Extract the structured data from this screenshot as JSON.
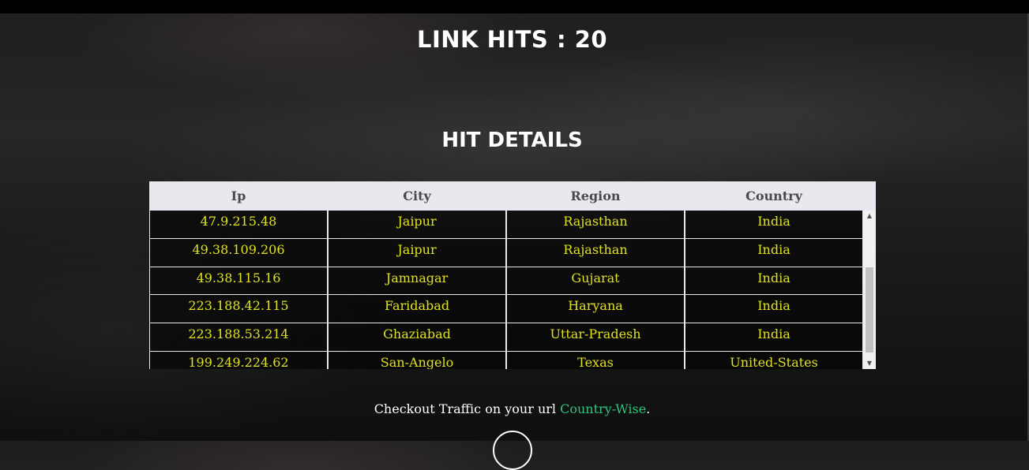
{
  "header": {
    "link_hits_label": "LINK HITS",
    "link_hits_separator": ":",
    "link_hits_count": "20"
  },
  "section": {
    "title": "HIT DETAILS"
  },
  "table": {
    "columns": [
      "Ip",
      "City",
      "Region",
      "Country"
    ],
    "rows": [
      [
        "47.9.215.48",
        "Jaipur",
        "Rajasthan",
        "India"
      ],
      [
        "49.38.109.206",
        "Jaipur",
        "Rajasthan",
        "India"
      ],
      [
        "49.38.115.16",
        "Jamnagar",
        "Gujarat",
        "India"
      ],
      [
        "223.188.42.115",
        "Faridabad",
        "Haryana",
        "India"
      ],
      [
        "223.188.53.214",
        "Ghaziabad",
        "Uttar-Pradesh",
        "India"
      ],
      [
        "199.249.224.62",
        "San-Angelo",
        "Texas",
        "United-States"
      ]
    ]
  },
  "footer": {
    "text_before": "Checkout Traffic on your url",
    "link_text": "Country-Wise",
    "text_after": "."
  },
  "icons": {
    "scroll_up": "scroll-up-arrow-icon",
    "scroll_down": "scroll-down-arrow-icon"
  },
  "colors": {
    "cell_text": "#e1e21f",
    "header_bg": "#e7e9ee",
    "link": "#2ec47e"
  }
}
